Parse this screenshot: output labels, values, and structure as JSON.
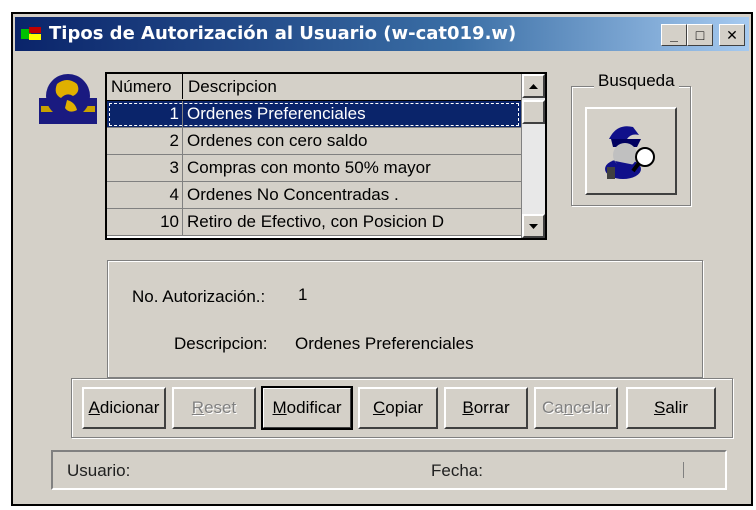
{
  "window": {
    "title": "Tipos de Autorización al Usuario  (w-cat019.w)",
    "controls": {
      "minimize": "_",
      "maximize": "□",
      "close": "✕"
    }
  },
  "browse": {
    "columns": [
      "Número",
      "Descripcion"
    ],
    "rows": [
      {
        "num": "1",
        "desc": "Ordenes Preferenciales",
        "selected": true
      },
      {
        "num": "2",
        "desc": "Ordenes con cero saldo"
      },
      {
        "num": "3",
        "desc": "Compras con monto 50% mayor"
      },
      {
        "num": "4",
        "desc": "Ordenes No Concentradas ."
      },
      {
        "num": "10",
        "desc": "Retiro de Efectivo, con Posicion D"
      }
    ]
  },
  "search": {
    "label": "Busqueda"
  },
  "details": {
    "auth_label": "No. Autorización.:",
    "auth_value": "1",
    "desc_label": "Descripcion:",
    "desc_value": "Ordenes Preferenciales"
  },
  "buttons": {
    "add": {
      "first": "A",
      "rest": "dicionar"
    },
    "reset": {
      "first": "R",
      "rest": "eset"
    },
    "modify": {
      "first": "M",
      "rest": "odificar"
    },
    "copy": {
      "first": "C",
      "rest": "opiar"
    },
    "delete": {
      "first": "B",
      "rest": "orrar"
    },
    "cancel": {
      "first": "Ca",
      "u": "n",
      "rest": "celar"
    },
    "exit": {
      "first": "S",
      "rest": "alir"
    }
  },
  "status": {
    "user_label": "Usuario:",
    "date_label": "Fecha:"
  },
  "colors": {
    "titlebar": "#0a246a",
    "selection": "#0a246a",
    "face": "#d4d0c8"
  }
}
